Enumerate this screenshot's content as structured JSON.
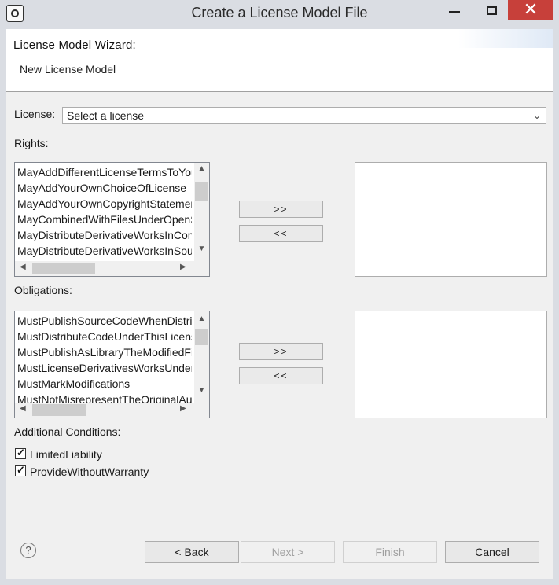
{
  "window": {
    "title": "Create a License Model File",
    "close_glyph": "✕"
  },
  "wizard": {
    "title": "License Model Wizard:",
    "subtitle": "New License Model"
  },
  "license": {
    "label": "License:",
    "placeholder": "Select a license"
  },
  "rights": {
    "label": "Rights:",
    "items": [
      "MayAddDifferentLicenseTermsToYourModifications",
      "MayAddYourOwnChoiceOfLicense",
      "MayAddYourOwnCopyrightStatement",
      "MayCombinedWithFilesUnderOpenSourceLicense",
      "MayDistributeDerivativeWorksInCompiledForm",
      "MayDistributeDerivativeWorksInSourceForm"
    ],
    "add_label": ">>",
    "remove_label": "<<"
  },
  "obligations": {
    "label": "Obligations:",
    "items": [
      "MustPublishSourceCodeWhenDistributing",
      "MustDistributeCodeUnderThisLicense",
      "MustPublishAsLibraryTheModifiedFiles",
      "MustLicenseDerivativesWorksUnderSameLicense",
      "MustMarkModifications",
      "MustNotMisrepresentTheOriginalAuthor"
    ],
    "add_label": ">>",
    "remove_label": "<<"
  },
  "conditions": {
    "label": "Additional Conditions:",
    "items": [
      {
        "label": "LimitedLiability",
        "checked": true
      },
      {
        "label": "ProvideWithoutWarranty",
        "checked": true
      }
    ]
  },
  "footer": {
    "help_glyph": "?",
    "back_label": "< Back",
    "next_label": "Next >",
    "finish_label": "Finish",
    "cancel_label": "Cancel"
  },
  "colors": {
    "titlebar": "#dadde3",
    "close": "#c7403a",
    "dialog_bg": "#f0f0f0"
  }
}
